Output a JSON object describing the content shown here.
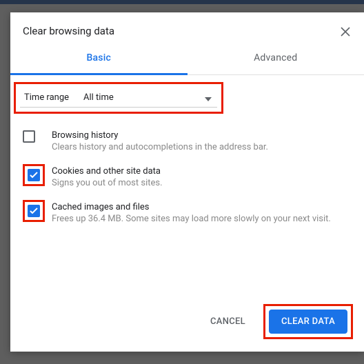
{
  "dialog": {
    "title": "Clear browsing data",
    "close_label": "Close"
  },
  "tabs": {
    "basic": "Basic",
    "advanced": "Advanced"
  },
  "time_range": {
    "label": "Time range",
    "value": "All time"
  },
  "options": [
    {
      "title": "Browsing history",
      "sub": "Clears history and autocompletions in the address bar.",
      "checked": false,
      "highlighted": false
    },
    {
      "title": "Cookies and other site data",
      "sub": "Signs you out of most sites.",
      "checked": true,
      "highlighted": true
    },
    {
      "title": "Cached images and files",
      "sub": "Frees up 36.4 MB. Some sites may load more slowly on your next visit.",
      "checked": true,
      "highlighted": true
    }
  ],
  "footer": {
    "cancel": "CANCEL",
    "clear": "CLEAR DATA"
  }
}
